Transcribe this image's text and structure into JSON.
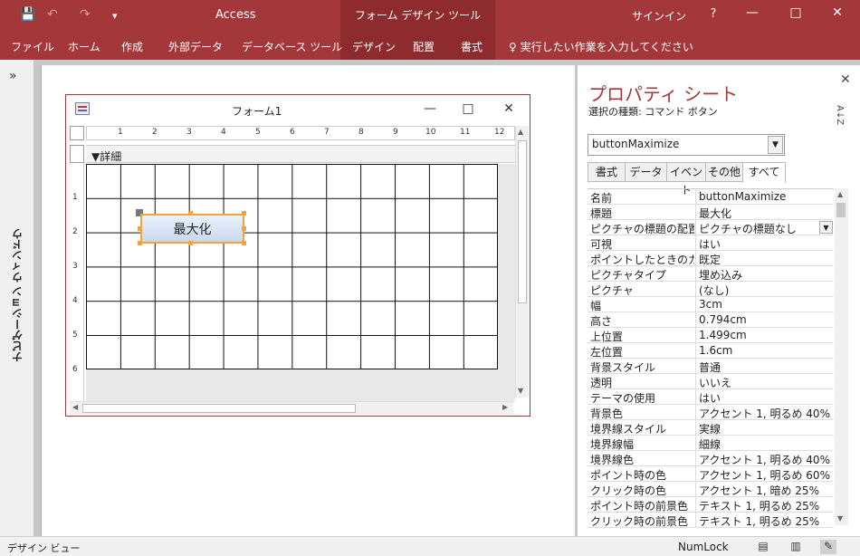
{
  "titlebar": {
    "app_title": "Access",
    "context_title": "フォーム デザイン ツール",
    "signin": "サインイン",
    "help": "?",
    "minimize": "—",
    "restore": "□",
    "close": "✕",
    "save_icon": "💾",
    "undo_icon": "↶",
    "redo_icon": "↷",
    "customize_icon": "▾"
  },
  "ribbon": {
    "tabs": [
      "ファイル",
      "ホーム",
      "作成",
      "外部データ",
      "データベース ツール",
      "デザイン",
      "配置",
      "書式"
    ],
    "tell_me": "♀ 実行したい作業を入力してください"
  },
  "nav_pane": {
    "expand": "»",
    "label": "ナビゲーション ウィンドウ"
  },
  "form_window": {
    "title": "フォーム1",
    "min": "—",
    "max": "□",
    "close": "✕",
    "section_label": "▼詳細",
    "ruler_h": [
      "1",
      "2",
      "3",
      "4",
      "5",
      "6",
      "7",
      "8",
      "9",
      "10",
      "11",
      "12"
    ],
    "ruler_v": [
      "1",
      "2",
      "3",
      "4",
      "5",
      "6"
    ],
    "button_caption": "最大化"
  },
  "property_sheet": {
    "title": "プロパティ シート",
    "close": "✕",
    "selection_type": "選択の種類: コマンド ボタン",
    "sort_icon": "A↓Z",
    "selected_object": "buttonMaximize",
    "tabs": [
      "書式",
      "データ",
      "イベント",
      "その他",
      "すべて"
    ],
    "rows": [
      {
        "name": "名前",
        "value": "buttonMaximize"
      },
      {
        "name": "標題",
        "value": "最大化"
      },
      {
        "name": "ピクチャの標題の配置",
        "value": "ピクチャの標題なし"
      },
      {
        "name": "可視",
        "value": "はい"
      },
      {
        "name": "ポイントしたときのカーソル",
        "value": "既定"
      },
      {
        "name": "ピクチャタイプ",
        "value": "埋め込み"
      },
      {
        "name": "ピクチャ",
        "value": "(なし)"
      },
      {
        "name": "幅",
        "value": "3cm"
      },
      {
        "name": "高さ",
        "value": "0.794cm"
      },
      {
        "name": "上位置",
        "value": "1.499cm"
      },
      {
        "name": "左位置",
        "value": "1.6cm"
      },
      {
        "name": "背景スタイル",
        "value": "普通"
      },
      {
        "name": "透明",
        "value": "いいえ"
      },
      {
        "name": "テーマの使用",
        "value": "はい"
      },
      {
        "name": "背景色",
        "value": "アクセント 1, 明るめ 40%"
      },
      {
        "name": "境界線スタイル",
        "value": "実線"
      },
      {
        "name": "境界線幅",
        "value": "細線"
      },
      {
        "name": "境界線色",
        "value": "アクセント 1, 明るめ 40%"
      },
      {
        "name": "ポイント時の色",
        "value": "アクセント 1, 明るめ 60%"
      },
      {
        "name": "クリック時の色",
        "value": "アクセント 1, 暗め 25%"
      },
      {
        "name": "ポイント時の前景色",
        "value": "テキスト 1, 明るめ 25%"
      },
      {
        "name": "クリック時の前景色",
        "value": "テキスト 1, 明るめ 25%"
      }
    ]
  },
  "statusbar": {
    "view": "デザイン ビュー",
    "numlock": "NumLock"
  },
  "colors": {
    "accent": "#a4373a",
    "accent_dark": "#8e2b2e",
    "selection": "#f2a33a"
  }
}
